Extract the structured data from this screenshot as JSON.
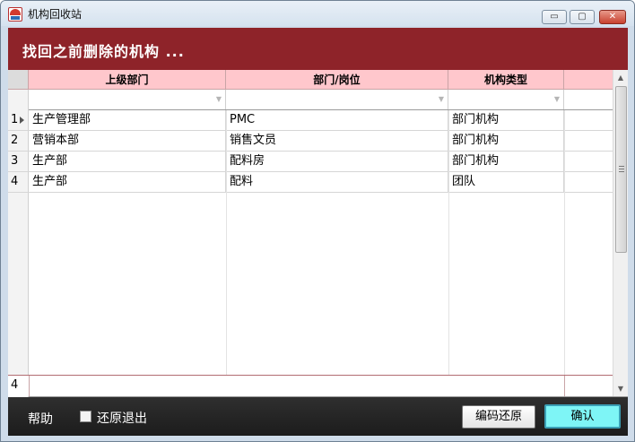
{
  "window": {
    "title": "机构回收站",
    "controls": {
      "minimize": "▭",
      "maximize": "▢",
      "close": "✕"
    }
  },
  "banner": {
    "text": "找回之前删除的机构 ..."
  },
  "grid": {
    "columns": [
      "上级部门",
      "部门/岗位",
      "机构类型"
    ],
    "rows": [
      {
        "num": "1",
        "parent": "生产管理部",
        "dept": "PMC",
        "type": "部门机构"
      },
      {
        "num": "2",
        "parent": "营销本部",
        "dept": "销售文员",
        "type": "部门机构"
      },
      {
        "num": "3",
        "parent": "生产部",
        "dept": "配料房",
        "type": "部门机构"
      },
      {
        "num": "4",
        "parent": "生产部",
        "dept": "配料",
        "type": "团队"
      }
    ],
    "footer_count": "4"
  },
  "bottom": {
    "help": "帮助",
    "restore_exit_label": "还原退出",
    "restore_exit_checked": false,
    "code_restore_button": "编码还原",
    "confirm_button": "确认"
  },
  "colors": {
    "banner": "#8e2329",
    "header_row": "#ffc7cc",
    "confirm_button": "#7ef5f6",
    "bottom_bar": "#2a2a2a"
  },
  "icons": [
    "app-logo-icon",
    "minimize-icon",
    "maximize-icon",
    "close-icon",
    "filter-dropdown-icon",
    "row-pointer-icon",
    "scroll-up-icon",
    "scroll-down-icon"
  ]
}
